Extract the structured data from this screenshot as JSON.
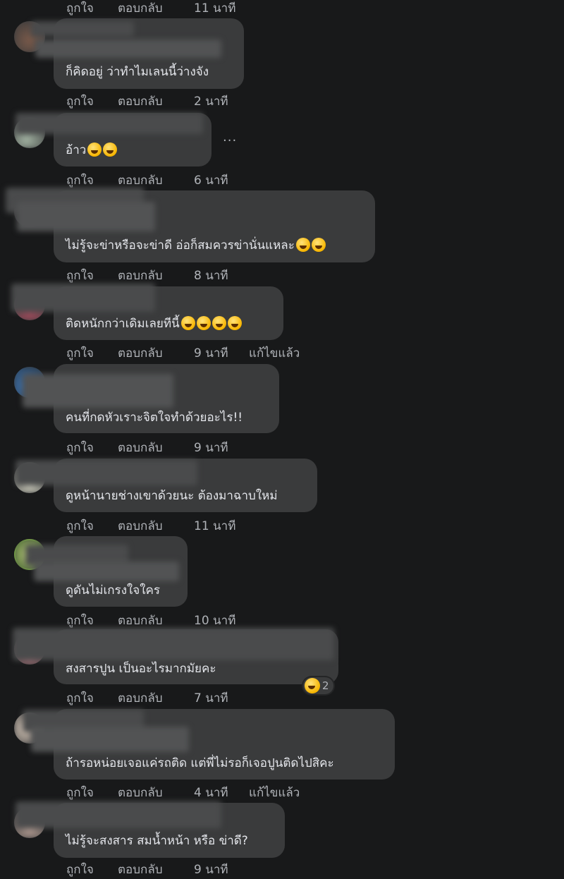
{
  "labels": {
    "like": "ถูกใจ",
    "reply": "ตอบกลับ",
    "edited": "แก้ไขแล้ว"
  },
  "more_options": "···",
  "comments": [
    {
      "time": "11 นาที"
    },
    {
      "text": "ก็คิดอยู่ ว่าทำไมเลนนี้ว่างจัง",
      "time": "2 นาที"
    },
    {
      "text": "อ้าว",
      "time": "6 นาที"
    },
    {
      "text": "ไม่รู้จะข่าหรือจะข่าดี อ่อก็สมควรข่านั่นแหละ",
      "time": "8 นาที"
    },
    {
      "text": "ติดหนักกว่าเดิมเลยทีนี้",
      "time": "9 นาที"
    },
    {
      "text": "คนที่กดหัวเราะจิตใจทำด้วยอะไร!!",
      "time": "9 นาที"
    },
    {
      "text": "ดูหน้านายช่างเขาด้วยนะ ต้องมาฉาบใหม่",
      "time": "11 นาที"
    },
    {
      "text": "ดูดันไม่เกรงใจใคร",
      "time": "10 นาที"
    },
    {
      "text": "สงสารปูน เป็นอะไรมากมัยคะ",
      "time": "7 นาที",
      "reaction_count": "2"
    },
    {
      "text": "ถ้ารอหน่อยเจอแค่รถติด แต่พี่ไม่รอก็เจอปูนติดไปสิคะ",
      "time": "4 นาที"
    },
    {
      "text": "ไม่รู้จะสงสาร สมน้ำหน้า หรือ ข่าดี?",
      "time": "9 นาที"
    }
  ],
  "colors": {
    "background": "#18191a",
    "bubble": "#3a3b3c",
    "text": "#e4e6eb",
    "meta": "#b0b3b8",
    "emoji": "#f7b500"
  },
  "icons": [
    "laugh-emoji-icon",
    "grin-emoji-icon",
    "more-options-icon"
  ]
}
